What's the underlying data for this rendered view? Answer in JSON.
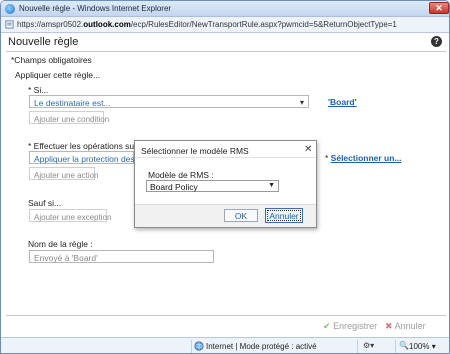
{
  "browser": {
    "title": "Nouvelle règle - Windows Internet Explorer",
    "url_prefix": "https://amspr0502.",
    "url_domain": "outlook.com",
    "url_suffix": "/ecp/RulesEditor/NewTransportRule.aspx?pwmcid=5&ReturnObjectType=1",
    "close_label": "✕"
  },
  "page": {
    "title": "Nouvelle règle",
    "help_label": "?",
    "required_note": "*Champs obligatoires",
    "apply_rule_label": "Appliquer cette règle..."
  },
  "condition": {
    "label": "* Si...",
    "select_value": "Le destinataire est...",
    "value_link": "'Board'",
    "add_button": "Ajouter une condition"
  },
  "action": {
    "label": "* Effectuer les opérations suivan",
    "select_value": "Appliquer la protection des dr",
    "value_link_prefix": "* ",
    "value_link": "Sélectionner un...",
    "add_button": "Ajouter une action"
  },
  "exception": {
    "label": "Sauf si...",
    "add_button": "Ajouter une exception"
  },
  "rule_name": {
    "label": "Nom de la règle :",
    "value": "Envoyé à 'Board'"
  },
  "dialog": {
    "title": "Sélectionner le modèle RMS",
    "close_label": "✕",
    "field_label": "Modèle de RMS :",
    "selected_template": "Board Policy",
    "ok_label": "OK",
    "cancel_label": "Annuler"
  },
  "footer": {
    "save_label": "Enregistrer",
    "cancel_label": "Annuler"
  },
  "statusbar": {
    "zone_text": "Internet | Mode protégé : activé",
    "zoom": "100%"
  },
  "colors": {
    "link": "#2c6aad",
    "titlebar": "#c3d6ee",
    "disabled_text": "#9c9c9c"
  }
}
